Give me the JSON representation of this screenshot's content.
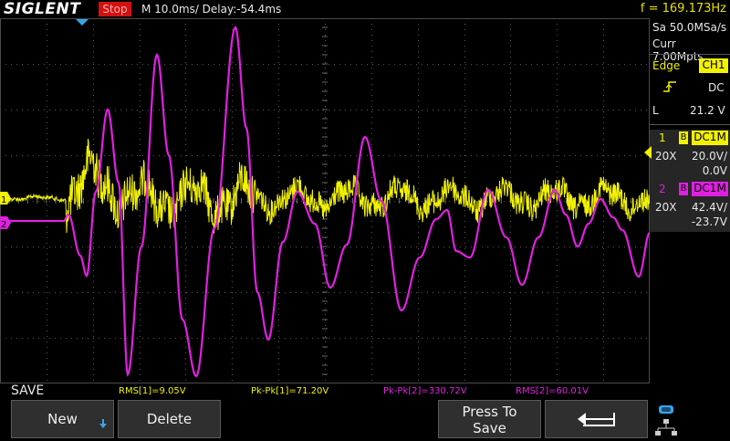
{
  "brand": "SIGLENT",
  "status": "Stop",
  "timebase": "M 10.0ms/ Delay:-54.4ms",
  "frequency": "f = 169.173Hz",
  "panel": {
    "sample_rate": "Sa 50.0MSa/s",
    "memory": "Curr 7.00Mpts",
    "trigger_type": "Edge",
    "trigger_source": "CH1",
    "trigger_coupling": "DC",
    "trigger_level_label": "L",
    "trigger_level": "21.2 V",
    "ch1": {
      "number": "1",
      "bw_badge": "B",
      "coupling": "DC1M",
      "probe": "20X",
      "scale": "20.0V/",
      "offset": "0.0V"
    },
    "ch2": {
      "number": "2",
      "bw_badge": "B",
      "coupling": "DC1M",
      "probe": "20X",
      "scale": "42.4V/",
      "offset": "-23.7V"
    }
  },
  "markers": {
    "ch1": "1",
    "ch2": "2"
  },
  "measurements": {
    "rms1": "RMS[1]=9.05V",
    "pkpk1": "Pk-Pk[1]=71.20V",
    "pkpk2": "Pk-Pk[2]=330.72V",
    "rms2": "RMS[2]=60.01V"
  },
  "menu_title": "SAVE",
  "softkeys": {
    "new": "New",
    "delete": "Delete",
    "press_to_save_line1": "Press To",
    "press_to_save_line2": "Save"
  },
  "icons": {
    "new_arrow": "arrow-down-icon",
    "back": "return-arrow-icon",
    "network": "network-status-icon"
  },
  "colors": {
    "ch1": "#f2f200",
    "ch2": "#e020e0",
    "status_bg": "#d21010",
    "frequency": "#e8e000"
  }
}
